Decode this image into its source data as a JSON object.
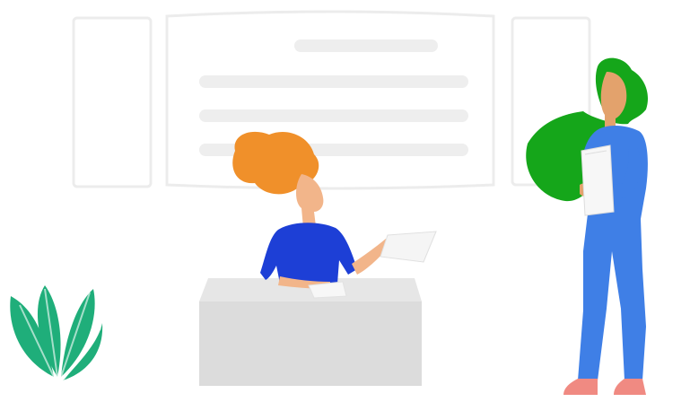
{
  "scene": {
    "description_free": true,
    "colors": {
      "background": "#ffffff",
      "wireframe_stroke": "#ececec",
      "wireframe_bar": "#eeeeee",
      "desk_top": "#e6e6e6",
      "desk_front": "#dcdcdc",
      "seated_hair": "#f0902a",
      "seated_skin": "#f2b58a",
      "seated_top": "#1d3fd6",
      "standing_hair": "#15a61a",
      "standing_skin": "#e3a26c",
      "standing_outfit": "#3f7fe6",
      "shoes": "#f08a82",
      "plant": "#1fae7a",
      "paper": "#f5f5f5"
    },
    "icons": [
      "wireframe-board-icon",
      "plant-icon",
      "paper-icon",
      "folder-icon"
    ]
  }
}
